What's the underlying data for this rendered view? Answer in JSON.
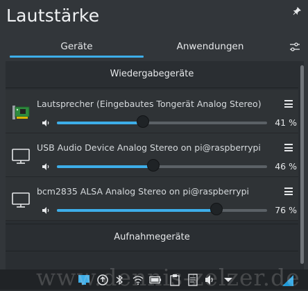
{
  "window": {
    "title": "Lautstärke"
  },
  "tabs": [
    {
      "label": "Geräte",
      "active": true
    },
    {
      "label": "Anwendungen",
      "active": false
    }
  ],
  "sections": {
    "playback": "Wiedergabegeräte",
    "recording": "Aufnahmegeräte"
  },
  "devices": [
    {
      "name": "Lautsprecher (Eingebautes Tongerät Analog Stereo)",
      "volume_percent": 41,
      "volume_label": "41 %",
      "icon": "sound-card-icon"
    },
    {
      "name": "USB Audio Device Analog Stereo on pi@raspberrypi",
      "volume_percent": 46,
      "volume_label": "46 %",
      "icon": "monitor-icon"
    },
    {
      "name": "bcm2835 ALSA Analog Stereo on pi@raspberrypi",
      "volume_percent": 76,
      "volume_label": "76 %",
      "icon": "monitor-icon"
    }
  ],
  "taskbar": {
    "icons": [
      "network-icon",
      "updates-icon",
      "bluetooth-icon",
      "wifi-icon",
      "battery-icon",
      "clipboard-icon",
      "notes-icon",
      "volume-icon",
      "chevron-down-icon",
      "app-launcher-icon"
    ]
  },
  "watermark": "www.dennis-zelzer.de",
  "colors": {
    "accent": "#3daee9",
    "background": "#32363a"
  }
}
